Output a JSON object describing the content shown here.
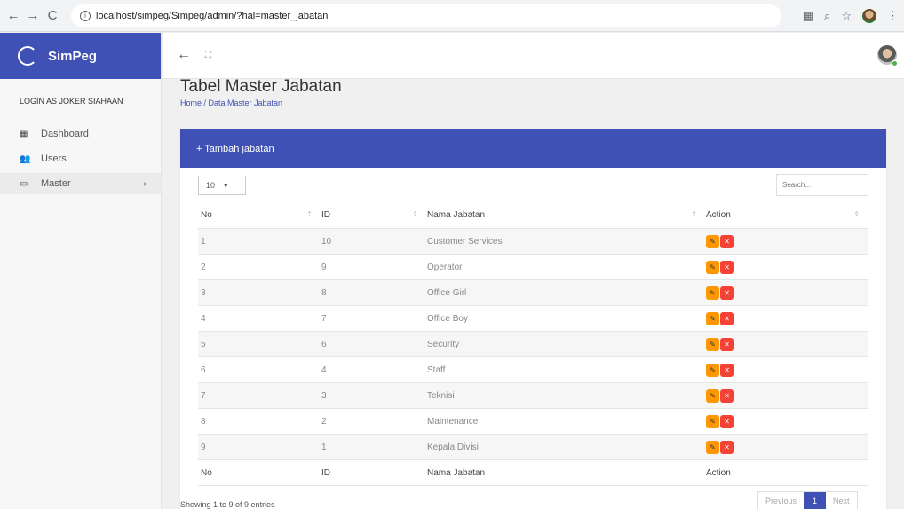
{
  "browser": {
    "url": "localhost/simpeg/Simpeg/admin/?hal=master_jabatan"
  },
  "sidebar": {
    "brand": "SimPeg",
    "login_as": "LOGIN AS JOKER SIAHAAN",
    "items": [
      {
        "label": "Dashboard"
      },
      {
        "label": "Users"
      },
      {
        "label": "Master"
      }
    ]
  },
  "page": {
    "title": "Tabel Master Jabatan",
    "breadcrumb": "Home / Data Master Jabatan"
  },
  "card": {
    "add_button": "+ Tambah jabatan",
    "length_value": "10",
    "search_placeholder": "Search..."
  },
  "table": {
    "headers": [
      "No",
      "ID",
      "Nama Jabatan",
      "Action"
    ],
    "rows": [
      [
        "1",
        "10",
        "Customer Services"
      ],
      [
        "2",
        "9",
        "Operator"
      ],
      [
        "3",
        "8",
        "Office Girl"
      ],
      [
        "4",
        "7",
        "Office Boy"
      ],
      [
        "5",
        "6",
        "Security"
      ],
      [
        "6",
        "4",
        "Staff"
      ],
      [
        "7",
        "3",
        "Teknisi"
      ],
      [
        "8",
        "2",
        "Maintenance"
      ],
      [
        "9",
        "1",
        "Kepala Divisi"
      ]
    ]
  },
  "footer": {
    "info": "Showing 1 to 9 of 9 entries",
    "prev": "Previous",
    "page": "1",
    "next": "Next"
  },
  "colors": {
    "primary": "#3f51b5",
    "edit": "#ff9800",
    "delete": "#f44336"
  }
}
